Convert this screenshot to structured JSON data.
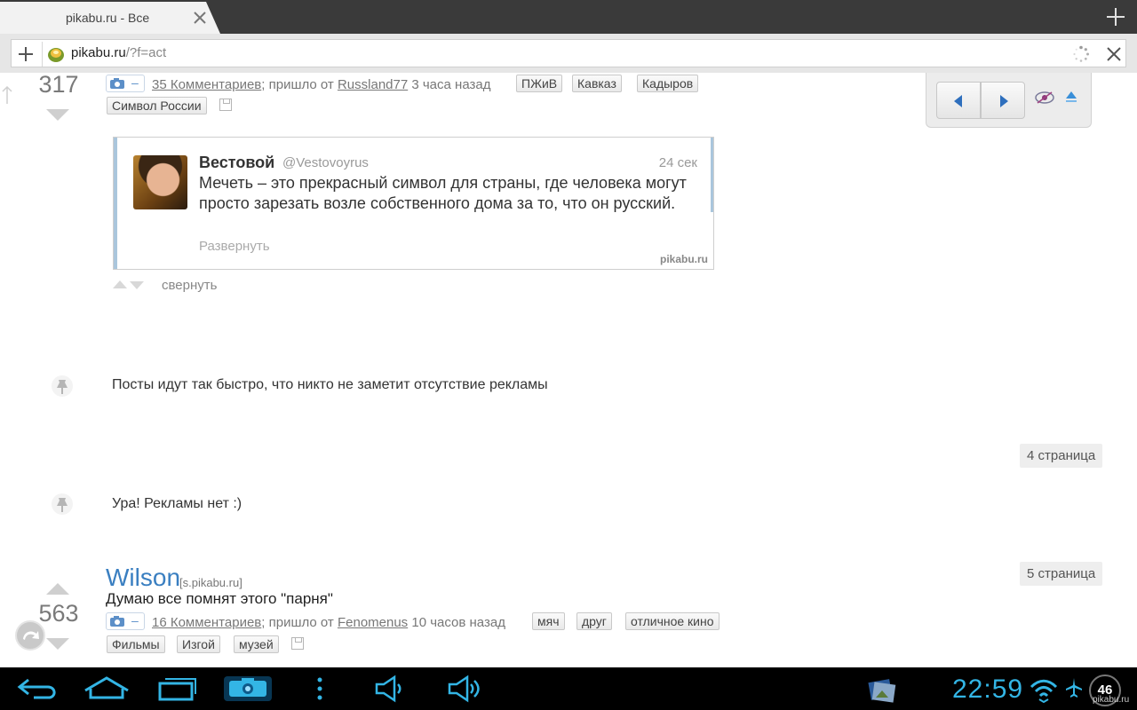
{
  "browser": {
    "tab_title": "pikabu.ru - Все",
    "url_host": "pikabu.ru",
    "url_path": "/?f=act"
  },
  "post1": {
    "score": "317",
    "comments": "35 Комментариев",
    "came_from": "; пришло от",
    "author": "Russland77",
    "time": "3 часа назад",
    "tags": [
      "ПЖиВ",
      "Кавказ",
      "Кадыров",
      "Символ России"
    ],
    "tweet": {
      "name": "Вестовой",
      "handle": "@Vestovoyrus",
      "time": "24 сек",
      "text": "Мечеть – это прекрасный символ для страны, где человека могут просто зарезать возле собственного дома за то, что он русский.",
      "expand": "Развернуть",
      "watermark": "pikabu.ru"
    },
    "collapse_label": "свернуть"
  },
  "notes": [
    "Посты идут так быстро, что никто не заметит отсутствие рекламы",
    "Ура! Рекламы нет :)"
  ],
  "page_badges": [
    "4 страница",
    "5 страница"
  ],
  "post2": {
    "author": "Wilson",
    "host": "[s.pikabu.ru]",
    "title": "Думаю все помнят этого \"парня\"",
    "score": "563",
    "comments": "16 Комментариев",
    "came_from": "; пришло от",
    "author_from": "Fenomenus",
    "time": "10 часов назад",
    "tags": [
      "мяч",
      "друг",
      "отличное кино",
      "Фильмы",
      "Изгой",
      "музей"
    ]
  },
  "system": {
    "clock": "22:59",
    "battery": "46",
    "watermark": "pikabu.ru"
  },
  "colors": {
    "accent": "#33b5e5",
    "link_blue": "#3a7fc1",
    "progress": "#2dbf3a"
  }
}
